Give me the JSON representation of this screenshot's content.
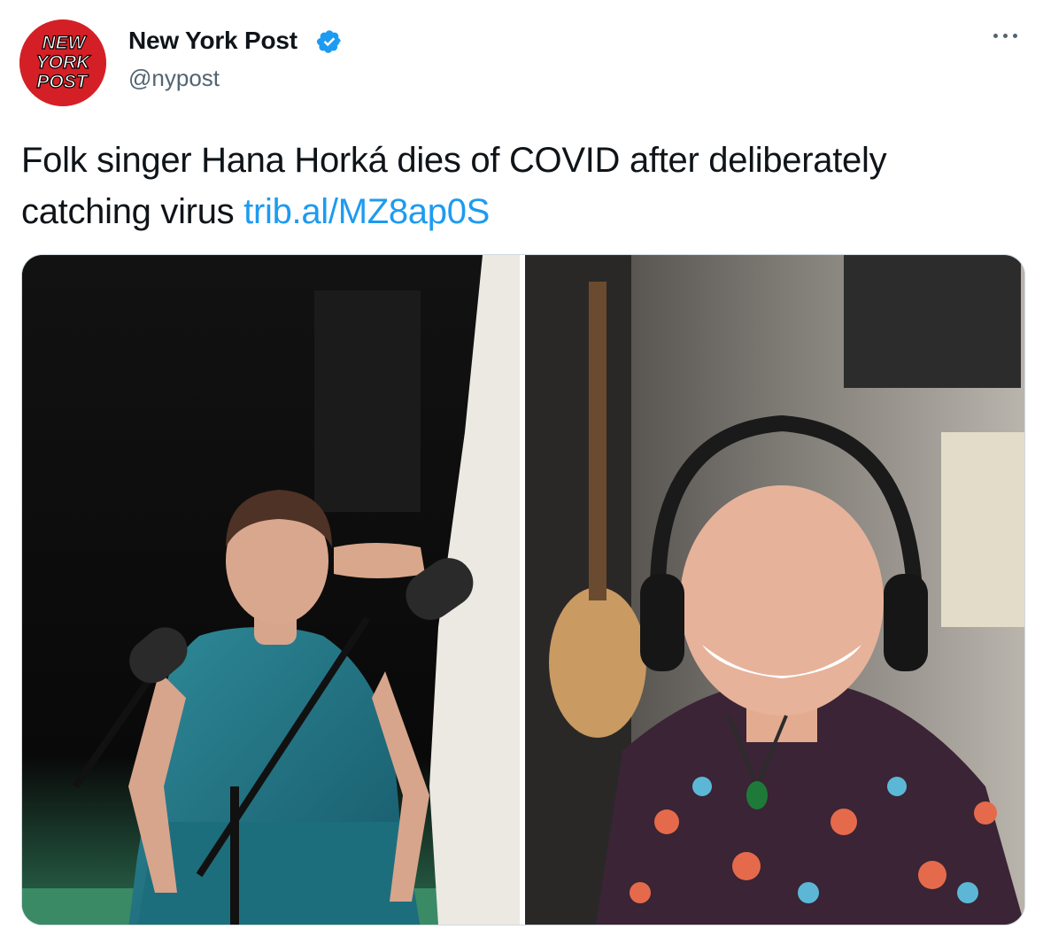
{
  "account": {
    "avatar_text": [
      "NEW",
      "YORK",
      "POST"
    ],
    "name": "New York Post",
    "handle": "@nypost",
    "verified": true
  },
  "tweet": {
    "text": "Folk singer Hana Horká dies of COVID after deliberately catching virus ",
    "link_text": "trib.al/MZ8ap0S"
  },
  "media": {
    "photo_count": 2
  },
  "colors": {
    "brand_red": "#d51f26",
    "link_blue": "#1d9bf0",
    "text": "#0f1419",
    "secondary": "#536471"
  },
  "icons": {
    "verified": "verified-badge-icon",
    "more": "more-options-icon"
  }
}
